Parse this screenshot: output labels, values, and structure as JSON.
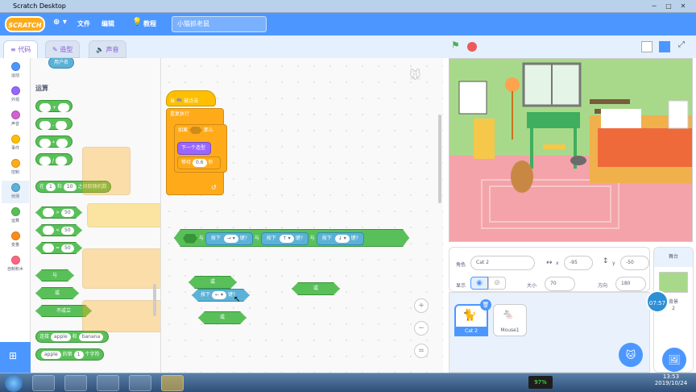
{
  "window": {
    "title": "Scratch Desktop",
    "min": "─",
    "max": "□",
    "close": "✕"
  },
  "menu": {
    "logo": "SCRATCH",
    "globe": "⊕ ▾",
    "file": "文件",
    "edit": "编辑",
    "tutorial": "教程",
    "project_name": "小猫抓老鼠"
  },
  "tabs": {
    "code": "代码",
    "costumes": "造型",
    "sounds": "声音"
  },
  "categories": [
    {
      "label": "运动",
      "color": "#4c97ff"
    },
    {
      "label": "外观",
      "color": "#9966ff"
    },
    {
      "label": "声音",
      "color": "#cf63cf"
    },
    {
      "label": "事件",
      "color": "#ffbf00"
    },
    {
      "label": "控制",
      "color": "#ffab19"
    },
    {
      "label": "侦测",
      "color": "#5cb1d6"
    },
    {
      "label": "运算",
      "color": "#59c059"
    },
    {
      "label": "变量",
      "color": "#ff8c1a"
    },
    {
      "label": "自制积木",
      "color": "#ff6680"
    }
  ],
  "palette": {
    "username": "用户名",
    "section": "运算",
    "ops": [
      "+",
      "-",
      "*",
      "/"
    ],
    "random": {
      "a": "在",
      "v1": "1",
      "b": "和",
      "v2": "10",
      "c": "之间取随机数"
    },
    "cmp": [
      {
        "op": ">",
        "v": "50"
      },
      {
        "op": "<",
        "v": "50"
      },
      {
        "op": "=",
        "v": "50"
      }
    ],
    "and": "与",
    "or": "或",
    "not": "不成立",
    "join": {
      "a": "连接",
      "v1": "apple",
      "b": "和",
      "v2": "banana"
    },
    "letter": {
      "v1": "apple",
      "a": "的第",
      "v2": "1",
      "b": "个字符"
    }
  },
  "script": {
    "hat": "当 🏁 被点击",
    "forever": "重复执行",
    "if": "如果",
    "then": "那么",
    "next_costume": "下一个造型",
    "wait": "等待",
    "wait_v": "0.6",
    "wait_unit": "秒",
    "loop_arrow": "↺"
  },
  "bigblock": {
    "and1": "与",
    "key1": "按下",
    "arrow1": "→ ▾",
    "q1": "键?",
    "and2": "与",
    "key2": "按下",
    "arrow2": "↑ ▾",
    "q2": "键?",
    "and3": "与",
    "key3": "按下",
    "arrow3": "↓ ▾",
    "q3": "键?"
  },
  "floating": {
    "or1": "或",
    "key": "按下",
    "arrow": "← ▾",
    "q": "键?",
    "or2": "或",
    "or3": "或"
  },
  "zoom": {
    "in": "+",
    "out": "−",
    "reset": "="
  },
  "sprite": {
    "label": "角色",
    "name": "Cat 2",
    "x_label": "x",
    "x": "-95",
    "y_label": "y",
    "y": "-50",
    "show": "显示",
    "size_label": "大小",
    "size": "70",
    "dir_label": "方向",
    "dir": "180"
  },
  "sprites": [
    {
      "name": "Cat 2"
    },
    {
      "name": "Mouse1"
    }
  ],
  "stage": {
    "label": "舞台",
    "backdrop": "背景",
    "count": "2"
  },
  "clock_overlay": "07:57",
  "taskbar": {
    "battery": "97%",
    "time": "13:53",
    "date": "2019/10/24"
  }
}
